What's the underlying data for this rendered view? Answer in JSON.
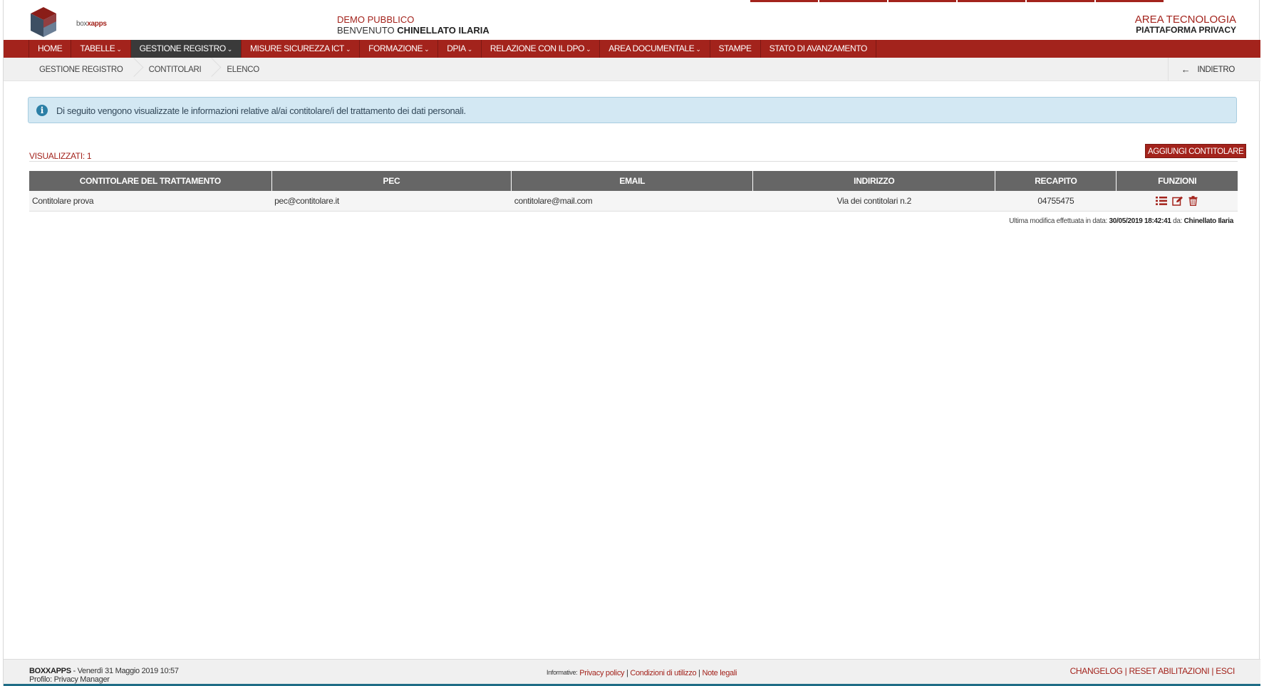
{
  "header": {
    "logo_text_a": "box",
    "logo_text_b": "xapps",
    "demo_label": "DEMO PUBBLICO",
    "welcome_label": "BENVENUTO",
    "user_name": "CHINELLATO ILARIA",
    "area_title": "AREA TECNOLOGIA",
    "platform_title": "PIATTAFORMA PRIVACY"
  },
  "nav": {
    "items": [
      {
        "label": "HOME",
        "dropdown": false
      },
      {
        "label": "TABELLE",
        "dropdown": true
      },
      {
        "label": "GESTIONE REGISTRO",
        "dropdown": true,
        "active": true
      },
      {
        "label": "MISURE SICUREZZA ICT",
        "dropdown": true
      },
      {
        "label": "FORMAZIONE",
        "dropdown": true
      },
      {
        "label": "DPIA",
        "dropdown": true
      },
      {
        "label": "RELAZIONE CON IL DPO",
        "dropdown": true
      },
      {
        "label": "AREA DOCUMENTALE",
        "dropdown": true
      },
      {
        "label": "STAMPE",
        "dropdown": false
      },
      {
        "label": "STATO DI AVANZAMENTO",
        "dropdown": false
      }
    ]
  },
  "breadcrumb": {
    "items": [
      "GESTIONE REGISTRO",
      "CONTITOLARI",
      "ELENCO"
    ],
    "back_label": "INDIETRO"
  },
  "alert": {
    "icon": "info-icon",
    "text": "Di seguito vengono visualizzate le informazioni relative al/ai contitolare/i del trattamento dei dati personali."
  },
  "list": {
    "count_label": "VISUALIZZATI: 1",
    "add_button": "AGGIUNGI CONTITOLARE",
    "columns": [
      "CONTITOLARE  DEL TRATTAMENTO",
      "PEC",
      "EMAIL",
      "INDIRIZZO",
      "RECAPITO",
      "FUNZIONI"
    ],
    "rows": [
      {
        "contitolare": "Contitolare prova",
        "pec": "pec@contitolare.it",
        "email": "contitolare@mail.com",
        "indirizzo": "Via dei contitolari n.2",
        "recapito": "04755475",
        "functions": [
          "list-icon",
          "edit-icon",
          "trash-icon"
        ]
      }
    ],
    "last_modified_prefix": "Ultima modifica effettuata in data:",
    "last_modified_date": "30/05/2019 18:42:41",
    "last_modified_by_label": "da:",
    "last_modified_user": "Chinellato Ilaria"
  },
  "footer": {
    "brand": "BOXXAPPS",
    "date_text": " - Venerdì 31 Maggio 2019 10:57",
    "profile_text": "Profilo: Privacy Manager",
    "info_label": "Informative:",
    "links": [
      "Privacy policy",
      "Condizioni di utilizzo",
      "Note legali"
    ],
    "right_links": [
      "CHANGELOG",
      "RESET ABILITAZIONI",
      "ESCI"
    ]
  },
  "colors": {
    "brand": "#a3231c",
    "nav_active": "#3a3a3a",
    "table_header": "#666666",
    "alert_bg": "#d3e8f3"
  }
}
